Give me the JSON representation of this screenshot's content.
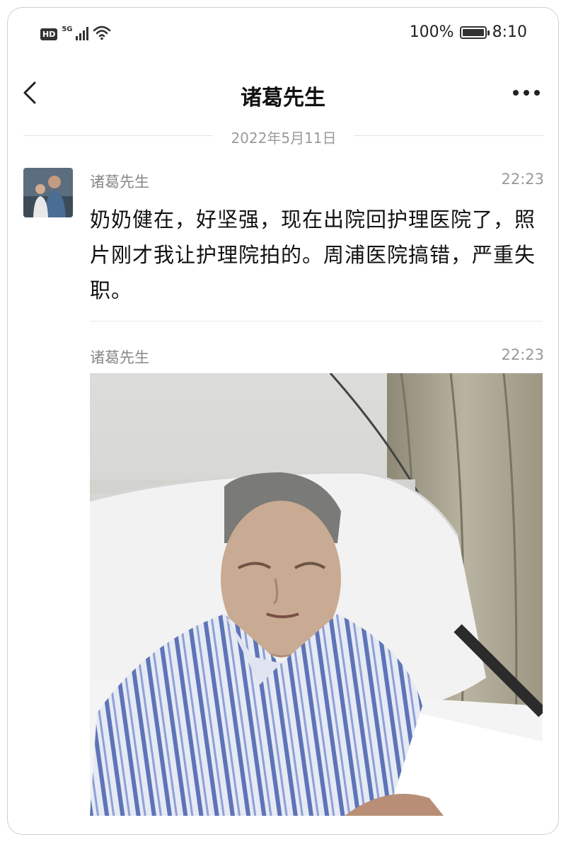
{
  "status_bar": {
    "hd_label": "HD",
    "network_label": "5G",
    "battery_text": "100%",
    "battery_level": 1.0,
    "time": "8:10"
  },
  "nav": {
    "title": "诸葛先生",
    "back_icon": "chevron-left-icon",
    "more_icon": "ellipsis-icon"
  },
  "date_divider": "2022年5月11日",
  "messages": [
    {
      "sender": "诸葛先生",
      "time": "22:23",
      "text": "奶奶健在，好坚强，现在出院回护理医院了，照片刚才我让护理院拍的。周浦医院搞错，严重失职。"
    },
    {
      "sender": "诸葛先生",
      "time": "22:23",
      "image": "photo-elderly-woman-in-hospital-bed"
    }
  ],
  "colors": {
    "text_primary": "#111111",
    "text_secondary": "#888888",
    "divider": "#e4e4e4"
  }
}
